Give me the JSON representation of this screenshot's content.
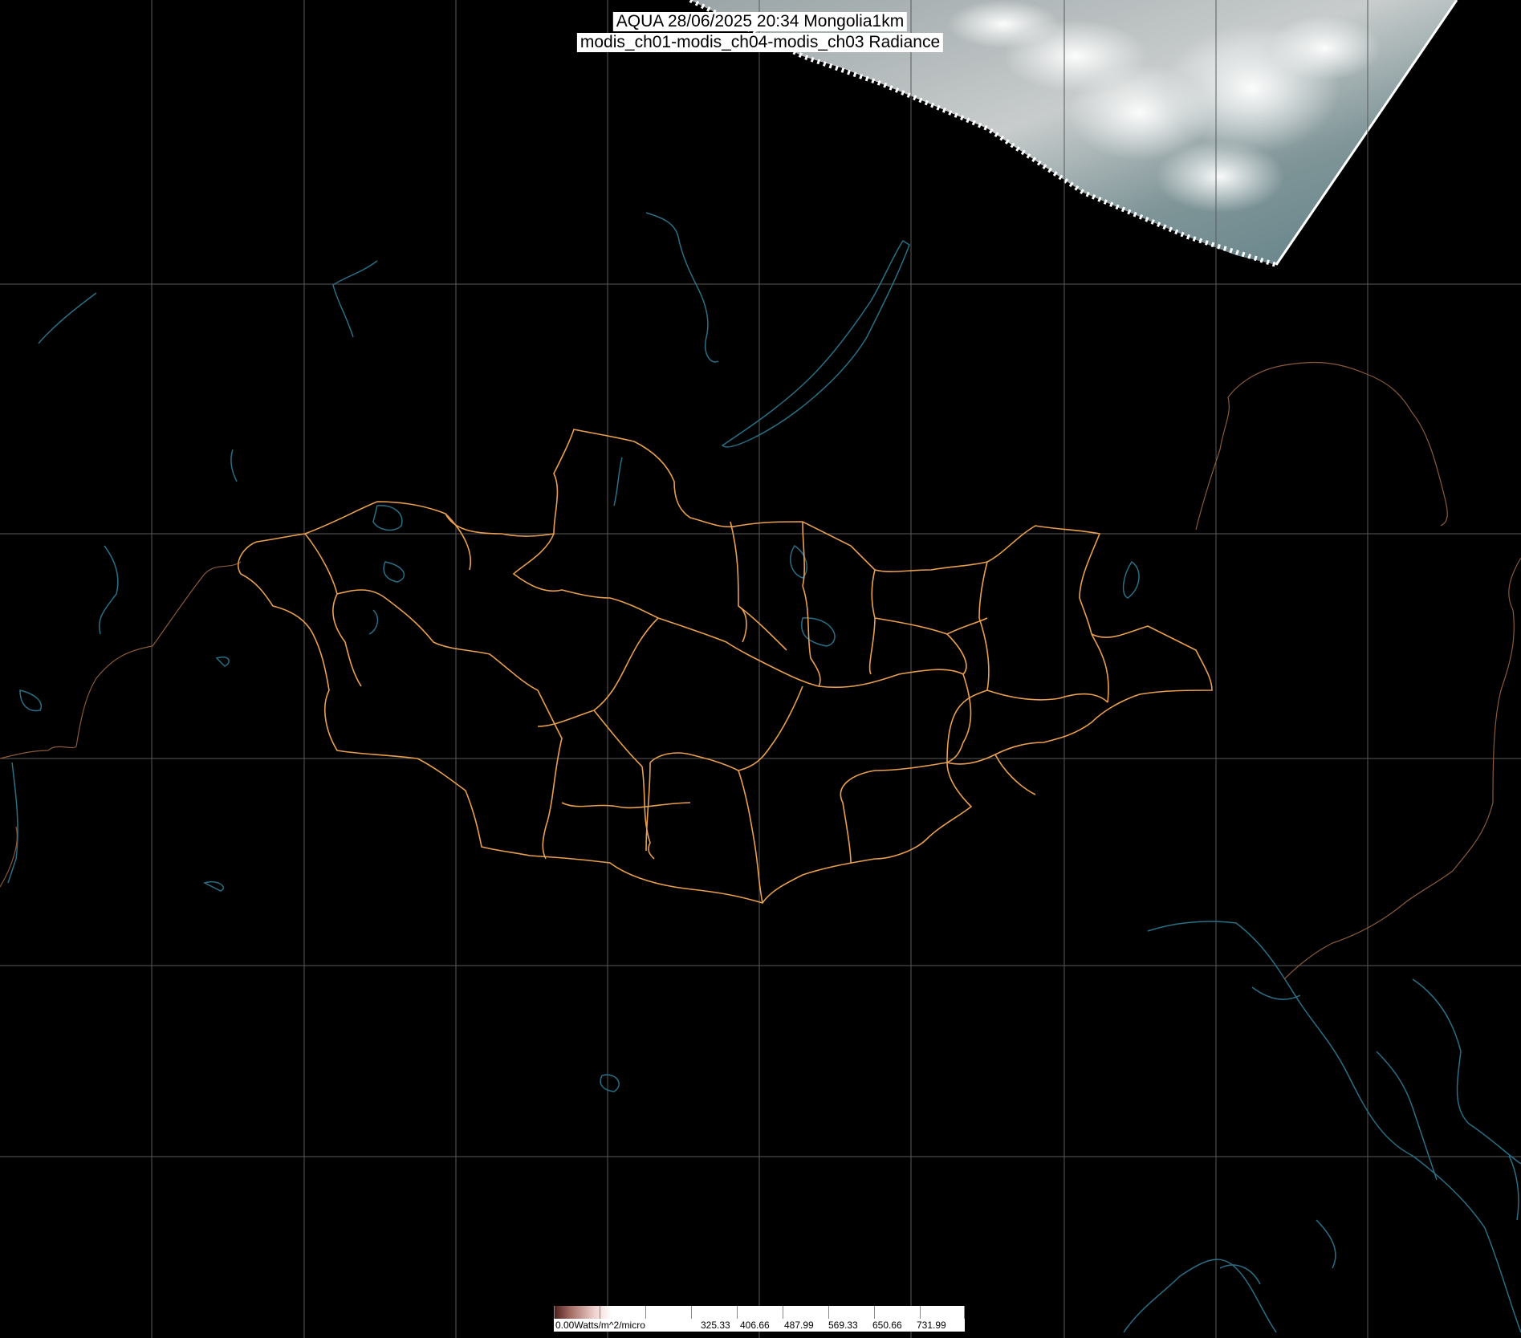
{
  "title": {
    "line1": "AQUA 28/06/2025 20:34 Mongolia1km",
    "line2": "modis_ch01-modis_ch04-modis_ch03 Radiance"
  },
  "colorbar": {
    "unit_label": "0.00Watts/m^2/micro",
    "tick_values": [
      "325.33",
      "406.66",
      "487.99",
      "569.33",
      "650.66",
      "731.99"
    ]
  },
  "colors": {
    "background": "#000000",
    "admin_border": "#e8a050",
    "coastline_water": "#2a6f86",
    "country_border": "#8a5a3a",
    "graticule": "#5a5a5a"
  },
  "map": {
    "layers": [
      "satellite-swath",
      "graticule-grid",
      "coastlines-lakes",
      "country-borders",
      "mongolia-province-borders"
    ]
  }
}
